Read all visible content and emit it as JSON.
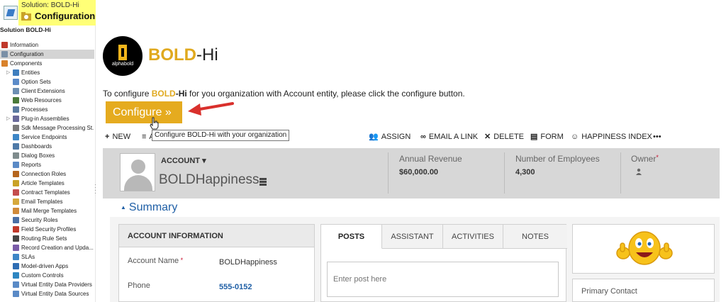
{
  "solution": {
    "subtitle": "Solution: BOLD-Hi",
    "title": "Configuration",
    "name": "Solution BOLD-Hi"
  },
  "tree": [
    {
      "label": "Information",
      "icon": "info-icon",
      "color": "#c0392b",
      "indent": 0
    },
    {
      "label": "Configuration",
      "icon": "config-icon",
      "color": "#7a8fa6",
      "indent": 0,
      "selected": true
    },
    {
      "label": "Components",
      "icon": "components-icon",
      "color": "#d9822b",
      "indent": 0
    },
    {
      "label": "Entities",
      "icon": "entities-icon",
      "color": "#3f7fbf",
      "indent": 1,
      "expandable": true
    },
    {
      "label": "Option Sets",
      "icon": "optionsets-icon",
      "color": "#5b8bc9",
      "indent": 1
    },
    {
      "label": "Client Extensions",
      "icon": "client-ext-icon",
      "color": "#6d8fb3",
      "indent": 1
    },
    {
      "label": "Web Resources",
      "icon": "webres-icon",
      "color": "#4a7a3a",
      "indent": 1
    },
    {
      "label": "Processes",
      "icon": "processes-icon",
      "color": "#5a7aa0",
      "indent": 1
    },
    {
      "label": "Plug-in Assemblies",
      "icon": "plugin-icon",
      "color": "#6a6a9a",
      "indent": 1,
      "expandable": true
    },
    {
      "label": "Sdk Message Processing St...",
      "icon": "sdk-icon",
      "color": "#7a7a7a",
      "indent": 1
    },
    {
      "label": "Service Endpoints",
      "icon": "endpoint-icon",
      "color": "#3d86c6",
      "indent": 1
    },
    {
      "label": "Dashboards",
      "icon": "dashboard-icon",
      "color": "#4e79a7",
      "indent": 1
    },
    {
      "label": "Dialog Boxes",
      "icon": "dialog-icon",
      "color": "#7f8c8d",
      "indent": 1
    },
    {
      "label": "Reports",
      "icon": "reports-icon",
      "color": "#5a8ac6",
      "indent": 1
    },
    {
      "label": "Connection Roles",
      "icon": "connection-icon",
      "color": "#b5651d",
      "indent": 1
    },
    {
      "label": "Article Templates",
      "icon": "article-icon",
      "color": "#c9a227",
      "indent": 1
    },
    {
      "label": "Contract Templates",
      "icon": "contract-icon",
      "color": "#c44d4d",
      "indent": 1
    },
    {
      "label": "Email Templates",
      "icon": "email-icon",
      "color": "#d6a83c",
      "indent": 1
    },
    {
      "label": "Mail Merge Templates",
      "icon": "mailmerge-icon",
      "color": "#d08a3a",
      "indent": 1
    },
    {
      "label": "Security Roles",
      "icon": "security-icon",
      "color": "#4a6fa5",
      "indent": 1
    },
    {
      "label": "Field Security Profiles",
      "icon": "field-security-icon",
      "color": "#c0392b",
      "indent": 1
    },
    {
      "label": "Routing Rule Sets",
      "icon": "routing-icon",
      "color": "#444444",
      "indent": 1
    },
    {
      "label": "Record Creation and Upda...",
      "icon": "record-creation-icon",
      "color": "#7a5ca8",
      "indent": 1
    },
    {
      "label": "SLAs",
      "icon": "sla-icon",
      "color": "#3d86c6",
      "indent": 1
    },
    {
      "label": "Model-driven Apps",
      "icon": "apps-icon",
      "color": "#2e6db4",
      "indent": 1
    },
    {
      "label": "Custom Controls",
      "icon": "custom-controls-icon",
      "color": "#2e86c1",
      "indent": 1
    },
    {
      "label": "Virtual Entity Data Providers",
      "icon": "vedp-icon",
      "color": "#5a8ac6",
      "indent": 1
    },
    {
      "label": "Virtual Entity Data Sources",
      "icon": "veds-icon",
      "color": "#5a8ac6",
      "indent": 1
    }
  ],
  "brand": {
    "logo_text": "alphabold",
    "name_part1": "BOLD",
    "name_part2": "-Hi"
  },
  "instruction": {
    "prefix": "To configure ",
    "brand_bold": "BOLD",
    "brand_hi": "-Hi",
    "suffix": " for you organization with Account entity, please click the configure button."
  },
  "configure_button": "Configure  »",
  "tooltip": "Configure BOLD-Hi with your organization",
  "commands": [
    {
      "label": "NEW",
      "icon": "plus-icon",
      "glyph": "+"
    },
    {
      "label": "ADD TO MARKETING LIST",
      "icon": "marketing-icon",
      "glyph": "≡"
    },
    {
      "label": "ASSIGN",
      "icon": "assign-icon",
      "glyph": "👥"
    },
    {
      "label": "EMAIL A LINK",
      "icon": "link-icon",
      "glyph": "∞"
    },
    {
      "label": "DELETE",
      "icon": "delete-icon",
      "glyph": "✕"
    },
    {
      "label": "FORM",
      "icon": "form-icon",
      "glyph": "▤"
    },
    {
      "label": "HAPPINESS INDEX",
      "icon": "smiley-icon",
      "glyph": "☺"
    },
    {
      "label": "•••",
      "icon": "more-icon",
      "glyph": ""
    }
  ],
  "record": {
    "entity_type": "ACCOUNT",
    "name": "BOLDHappiness",
    "kpis": [
      {
        "label": "Annual Revenue",
        "value": "$60,000.00"
      },
      {
        "label": "Number of Employees",
        "value": "4,300"
      },
      {
        "label": "Owner",
        "value": "",
        "required": true
      }
    ]
  },
  "summary": "Summary",
  "account_info": {
    "header": "ACCOUNT INFORMATION",
    "fields": [
      {
        "label": "Account Name",
        "value": "BOLDHappiness",
        "required": true
      },
      {
        "label": "Phone",
        "value": "555-0152",
        "link": true
      }
    ]
  },
  "social_tabs": [
    "POSTS",
    "ASSISTANT",
    "ACTIVITIES",
    "NOTES"
  ],
  "post_placeholder": "Enter post here",
  "primary_contact_label": "Primary Contact",
  "colors": {
    "brand_gold": "#e5ab1f",
    "header_gray": "#d7d7d7",
    "link_blue": "#1f5fa6",
    "arrow_red": "#d9302c"
  }
}
